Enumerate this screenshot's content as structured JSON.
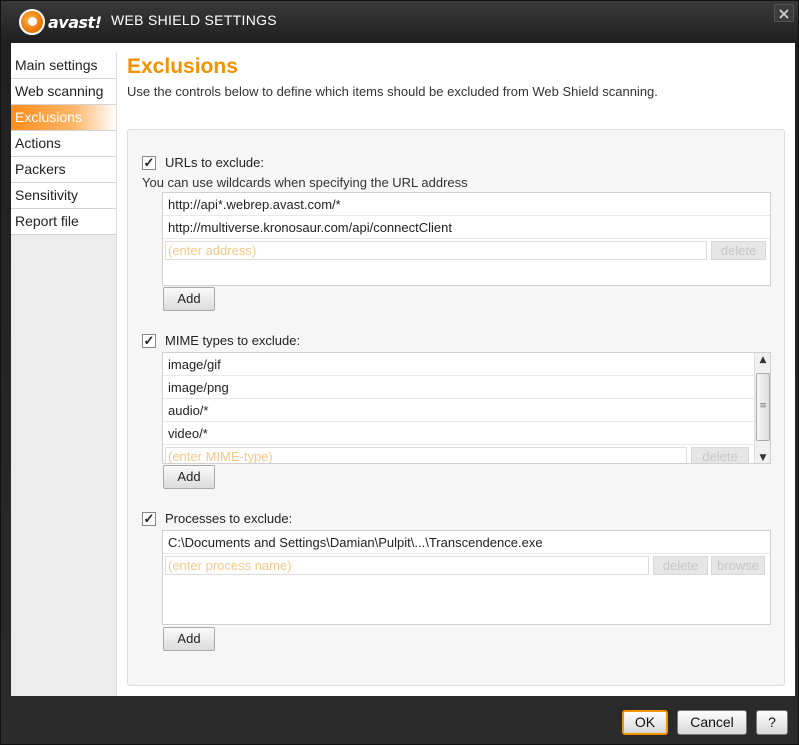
{
  "window": {
    "logo_text": "avast!",
    "title": "WEB SHIELD SETTINGS",
    "close_glyph": "×"
  },
  "sidebar": {
    "items": [
      {
        "label": "Main settings"
      },
      {
        "label": "Web scanning"
      },
      {
        "label": "Exclusions",
        "active": true
      },
      {
        "label": "Actions"
      },
      {
        "label": "Packers"
      },
      {
        "label": "Sensitivity"
      },
      {
        "label": "Report file"
      }
    ]
  },
  "main": {
    "heading": "Exclusions",
    "intro": "Use the controls below to define which items should be excluded from Web Shield scanning."
  },
  "urls": {
    "checked": true,
    "label": "URLs to exclude:",
    "hint": "You can use wildcards when specifying the URL address",
    "items": [
      "http://api*.webrep.avast.com/*",
      "http://multiverse.kronosaur.com/api/connectClient"
    ],
    "placeholder": "(enter address)",
    "delete_label": "delete",
    "add_label": "Add"
  },
  "mime": {
    "checked": true,
    "label": "MIME types to exclude:",
    "items": [
      "image/gif",
      "image/png",
      "audio/*",
      "video/*"
    ],
    "placeholder": "(enter MIME-type)",
    "delete_label": "delete",
    "add_label": "Add"
  },
  "processes": {
    "checked": true,
    "label": "Processes to exclude:",
    "items": [
      "C:\\Documents and Settings\\Damian\\Pulpit\\...\\Transcendence.exe"
    ],
    "placeholder": "(enter process name)",
    "delete_label": "delete",
    "browse_label": "browse",
    "add_label": "Add"
  },
  "footer": {
    "ok_label": "OK",
    "cancel_label": "Cancel",
    "help_label": "?"
  },
  "colors": {
    "accent": "#f39200",
    "title_bar": "#2b2b2b",
    "placeholder": "#f5c88a"
  },
  "icons": {
    "logo": "avast-logo-icon",
    "close": "close-icon",
    "checkbox": "checkmark-icon",
    "scroll_up": "arrow-up-icon",
    "scroll_down": "arrow-down-icon"
  }
}
